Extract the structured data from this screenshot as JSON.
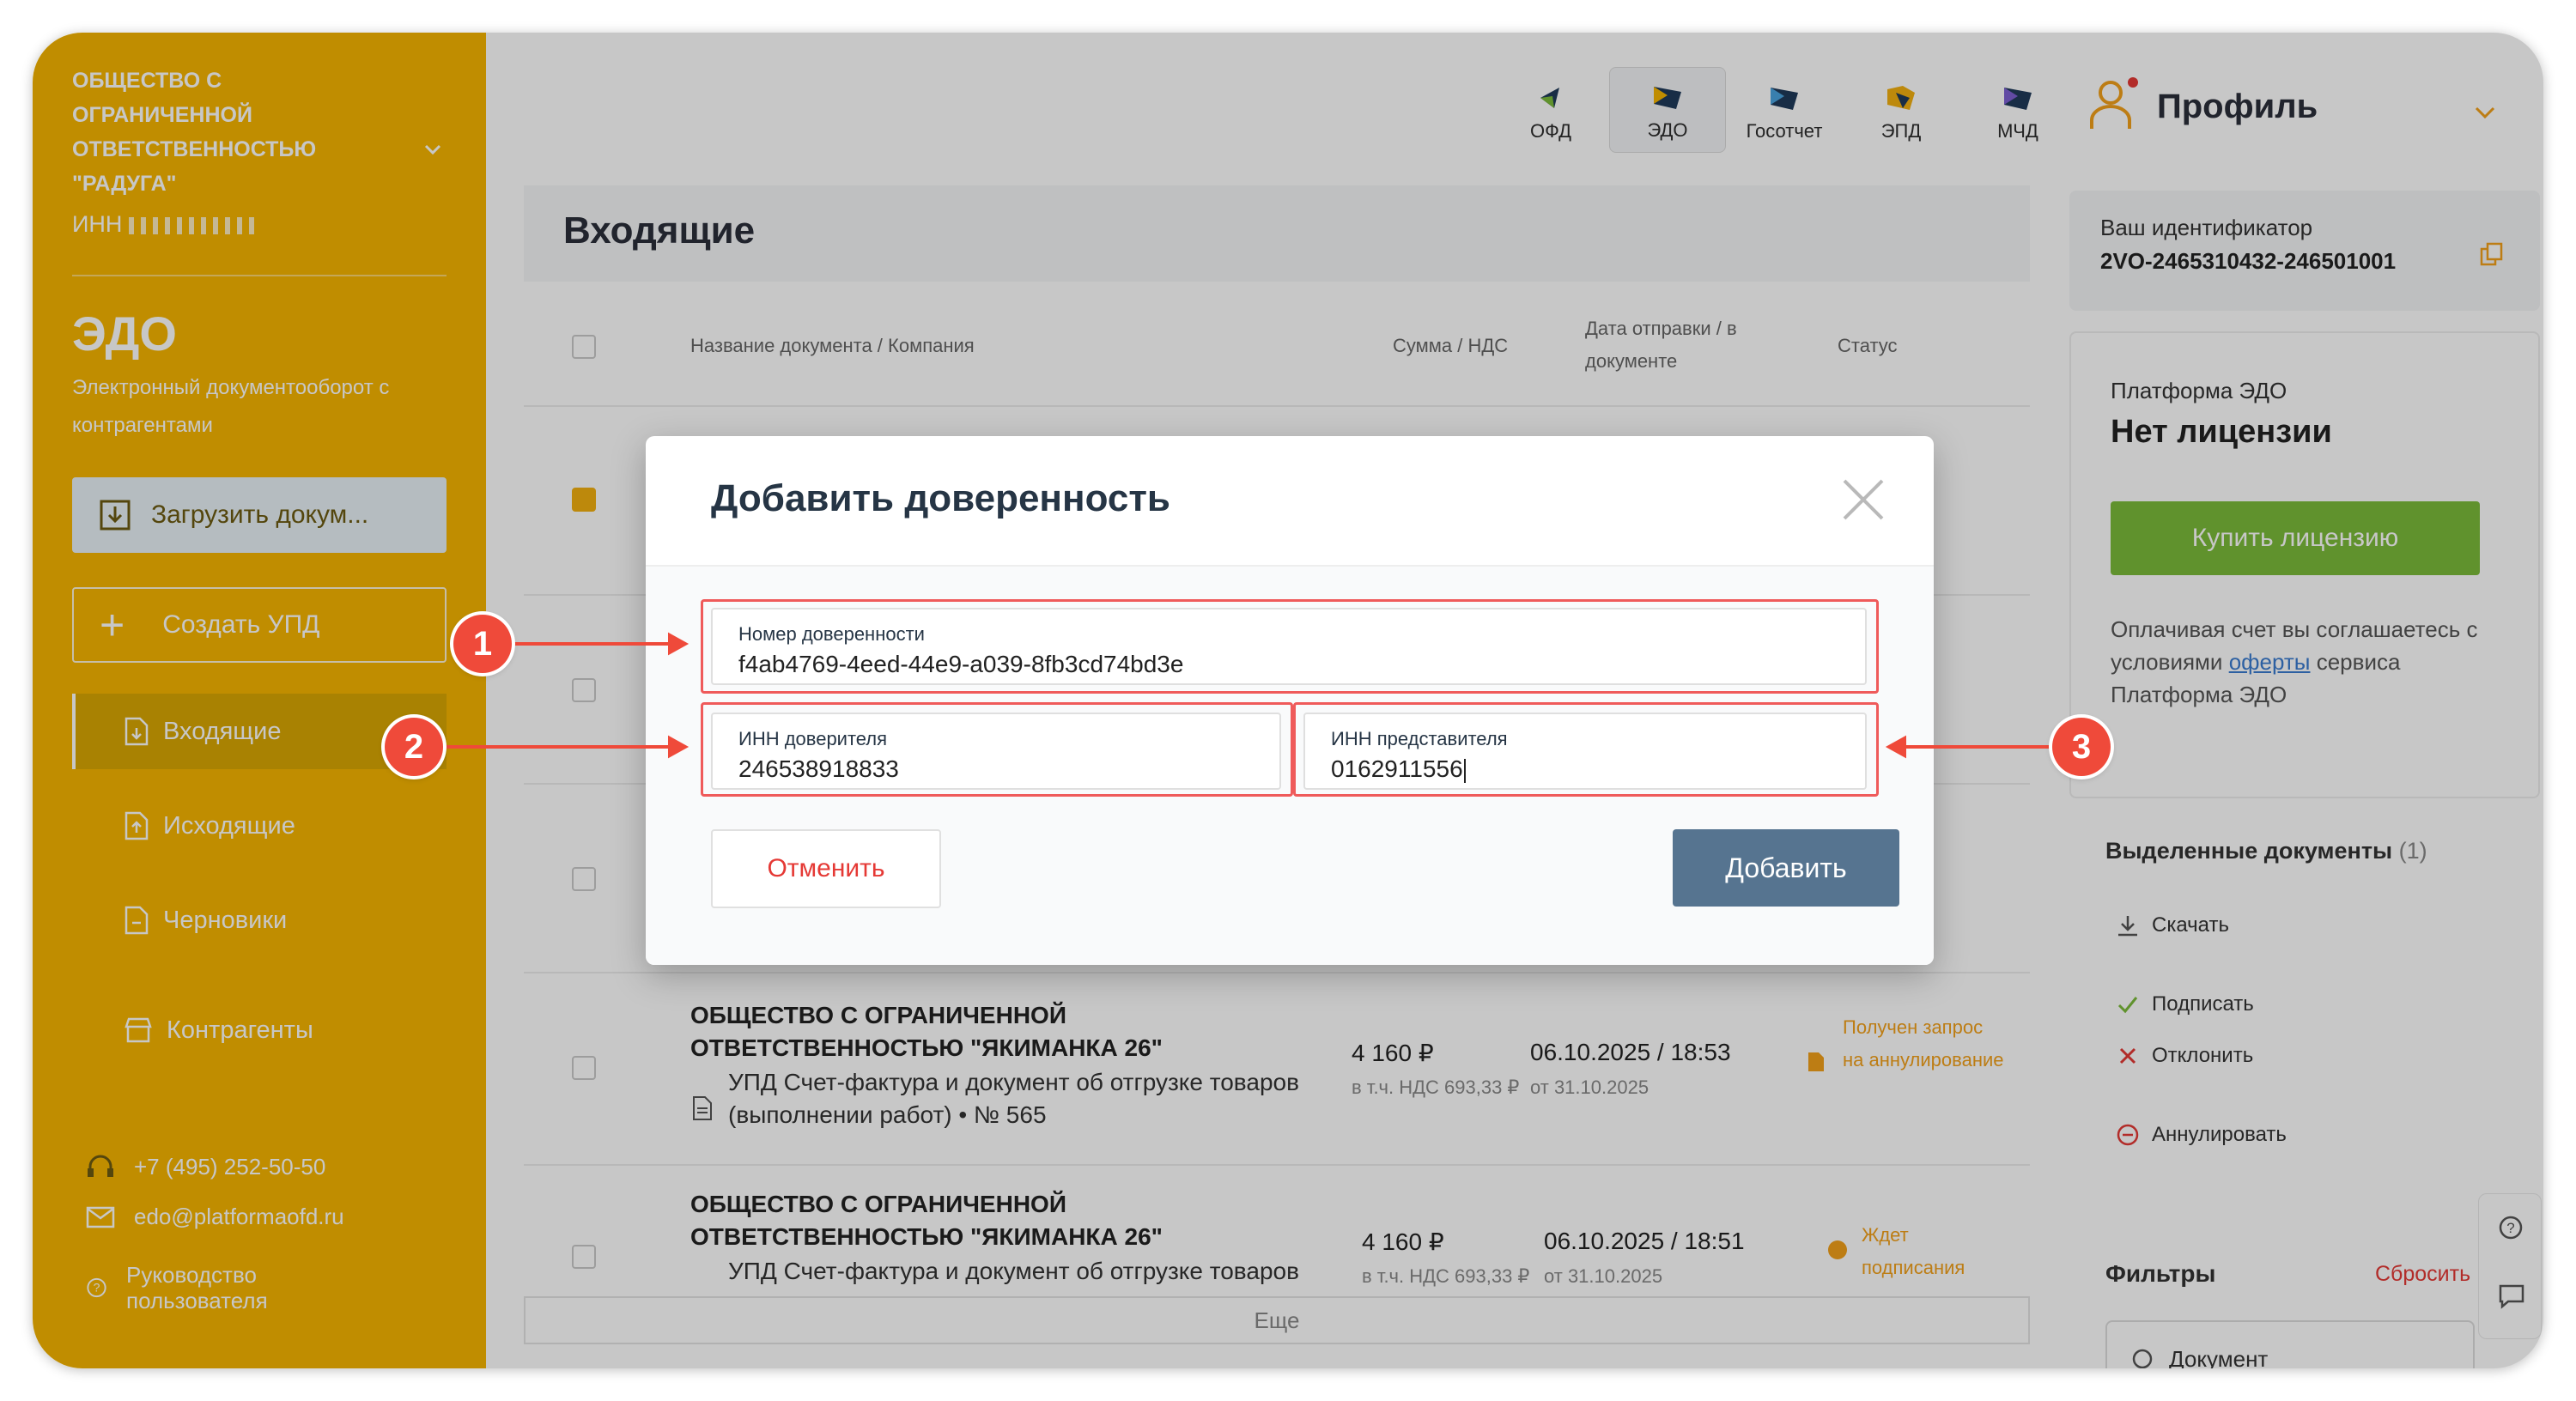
{
  "sidebar": {
    "org_name": "ОБЩЕСТВО С ОГРАНИЧЕННОЙ ОТВЕТСТВЕННОСТЬЮ \"РАДУГА\"",
    "inn_label": "ИНН",
    "section_title": "ЭДО",
    "section_subtitle": "Электронный документооборот с контрагентами",
    "upload_label": "Загрузить докум...",
    "create_label": "Создать УПД",
    "nav": [
      "Входящие",
      "Исходящие",
      "Черновики",
      "Контрагенты"
    ],
    "phone": "+7 (495) 252-50-50",
    "email": "edo@platformaofd.ru",
    "guide": "Руководство пользователя"
  },
  "top_nav": [
    "ОФД",
    "ЭДО",
    "Госотчет",
    "ЭПД",
    "МЧД"
  ],
  "main": {
    "title": "Входящие",
    "columns": {
      "name": "Название документа / Компания",
      "sum": "Сумма / НДС",
      "date": "Дата отправки / в документе",
      "status": "Статус"
    },
    "rows": [
      {
        "company": "ОБЩЕСТВО С ОГРАНИЧЕННОЙ ОТВЕТСТВЕННОСТЬЮ \"ЯКИМАНКА 26\"",
        "doc": "УПД Счет-фактура и документ об отгрузке товаров (выполнении работ) • № 565",
        "amount": "4 160 ₽",
        "vat": "в т.ч. НДС 693,33 ₽",
        "date": "06.10.2025 / 18:53",
        "date_doc": "от 31.10.2025",
        "status": "Получен запрос на аннулирование"
      },
      {
        "company": "ОБЩЕСТВО С ОГРАНИЧЕННОЙ ОТВЕТСТВЕННОСТЬЮ \"ЯКИМАНКА 26\"",
        "doc": "УПД Счет-фактура и документ об отгрузке товаров",
        "amount": "4 160 ₽",
        "vat": "в т.ч. НДС 693,33 ₽",
        "date": "06.10.2025 / 18:51",
        "date_doc": "от 31.10.2025",
        "status": "Ждет подписания"
      }
    ],
    "more_label": "Еще"
  },
  "right": {
    "profile": "Профиль",
    "id_label": "Ваш идентификатор",
    "id_value": "2VO-2465310432-246501001",
    "platform_label": "Платформа ЭДО",
    "license_value": "Нет лицензии",
    "buy_label": "Купить лицензию",
    "offer_pre": "Оплачивая счет вы соглашаетесь с условиями",
    "offer_link": "оферты",
    "offer_post": "сервиса Платформа ЭДО",
    "selected_title": "Выделенные документы",
    "selected_count": "(1)",
    "actions": [
      "Скачать",
      "Подписать",
      "Отклонить",
      "Аннулировать"
    ],
    "filters_title": "Фильтры",
    "reset_label": "Сбросить",
    "filter_document": "Документ"
  },
  "modal": {
    "title": "Добавить доверенность",
    "number_label": "Номер доверенности",
    "number_value": "f4ab4769-4eed-44e9-a039-8fb3cd74bd3e",
    "principal_label": "ИНН доверителя",
    "principal_value": "246538918833",
    "rep_label": "ИНН представителя",
    "rep_value": "0162911556",
    "cancel_label": "Отменить",
    "add_label": "Добавить"
  },
  "callouts": [
    "1",
    "2",
    "3"
  ],
  "colors": {
    "sidebar": "#f7b500",
    "accent_button": "#567490",
    "callout": "#ef4a3a",
    "buy_button": "#7cbb3a"
  }
}
